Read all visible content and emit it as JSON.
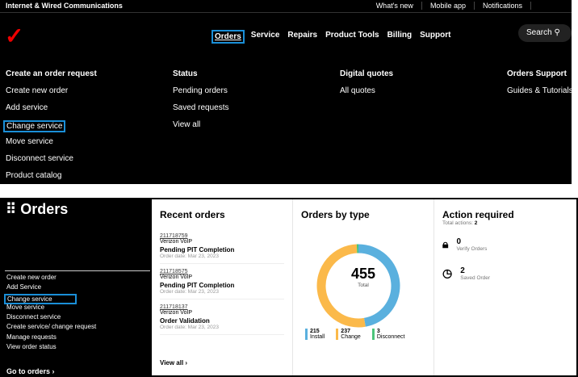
{
  "utility": {
    "brand": "Internet & Wired Communications",
    "links": [
      "What's new",
      "Mobile app",
      "Notifications"
    ]
  },
  "logo": "✓",
  "nav": [
    "Orders",
    "Service",
    "Repairs",
    "Product Tools",
    "Billing",
    "Support"
  ],
  "search": "Search",
  "menu": [
    {
      "title": "Create an order request",
      "items": [
        "Create new order",
        "Add service",
        "Change service",
        "Move service",
        "Disconnect service",
        "Product catalog"
      ]
    },
    {
      "title": "Status",
      "items": [
        "Pending orders",
        "Saved requests",
        "View all"
      ]
    },
    {
      "title": "Digital quotes",
      "items": [
        "All quotes"
      ]
    },
    {
      "title": "Orders Support",
      "items": [
        "Guides & Tutorials"
      ]
    }
  ],
  "sidebar": {
    "title": "Orders",
    "links": [
      "Create new order",
      "Add Service",
      "Change service",
      "Move service",
      "Disconnect service",
      "Create service/ change request",
      "Manage requests",
      "View order status"
    ],
    "go": "Go to orders ›"
  },
  "recent": {
    "title": "Recent orders",
    "orders": [
      {
        "id": "211718759",
        "product": "Verizon VoIP",
        "status": "Pending PIT Completion",
        "date": "Order date: Mar 23, 2023"
      },
      {
        "id": "211718575",
        "product": "Verizon VoIP",
        "status": "Pending PIT Completion",
        "date": "Order date: Mar 23, 2023"
      },
      {
        "id": "211718137",
        "product": "Verizon VoIP",
        "status": "Order Validation",
        "date": "Order date: Mar 23, 2023"
      }
    ],
    "view_all": "View all ›"
  },
  "chart_data": {
    "type": "pie",
    "title": "Orders by type",
    "total": "455",
    "total_label": "Total",
    "series": [
      {
        "name": "Install",
        "value": 215,
        "color": "#5ab0de"
      },
      {
        "name": "Change",
        "value": 237,
        "color": "#fbb94a"
      },
      {
        "name": "Disconnect",
        "value": 3,
        "color": "#4cc47a"
      }
    ]
  },
  "action": {
    "title": "Action required",
    "total_label": "Total actions:",
    "total": "2",
    "items": [
      {
        "count": "0",
        "label": "Verify Orders"
      },
      {
        "count": "2",
        "label": "Saved Order"
      }
    ]
  }
}
